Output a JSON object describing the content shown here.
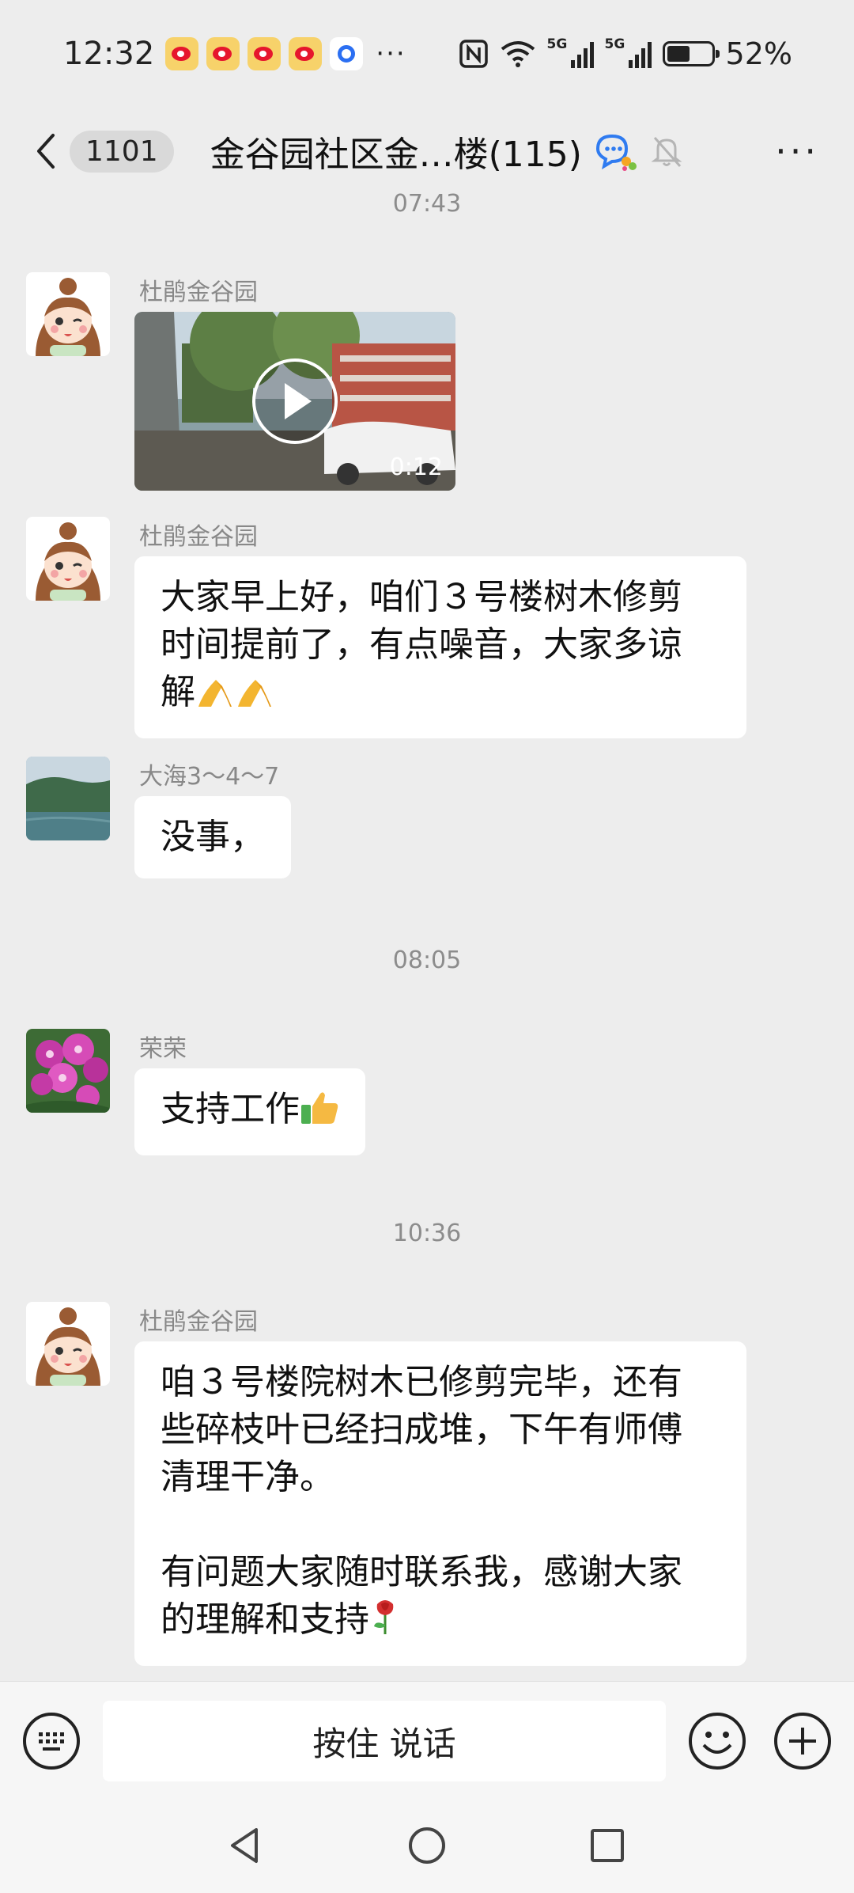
{
  "status_bar": {
    "time": "12:32",
    "more": "···",
    "net1": "5G",
    "net2": "5G",
    "battery": "52%"
  },
  "header": {
    "unread_count": "1101",
    "title": "金谷园社区金…楼(115)",
    "more": "···"
  },
  "chat": {
    "timestamps": [
      "07:43",
      "08:05",
      "10:36"
    ],
    "messages": [
      {
        "sender": "杜鹃金谷园",
        "type": "video",
        "duration": "0:12"
      },
      {
        "sender": "杜鹃金谷园",
        "lines": [
          "大家早上好，咱们３号楼树木修剪",
          "时间提前了，有点噪音，大家多谅",
          "解"
        ]
      },
      {
        "sender": "大海3～4～7",
        "lines": [
          "没事，"
        ]
      },
      {
        "sender": "荣荣",
        "lines": [
          "支持工作"
        ]
      },
      {
        "sender": "杜鹃金谷园",
        "lines": [
          "咱３号楼院树木已修剪完毕，还有",
          "些碎枝叶已经扫成堆，下午有师傅",
          "清理干净。",
          "",
          "有问题大家随时联系我，感谢大家",
          "的理解和支持"
        ]
      }
    ]
  },
  "input_bar": {
    "voice_label": "按住 说话"
  },
  "icons": [
    "back-icon",
    "group-chat-icon",
    "mute-bell-icon",
    "keyboard-icon",
    "emoji-icon",
    "plus-icon",
    "nav-back-icon",
    "nav-home-icon",
    "nav-recents-icon"
  ],
  "colors": {
    "background": "#ededed",
    "bubble": "#ffffff",
    "meta_text": "#888888"
  }
}
